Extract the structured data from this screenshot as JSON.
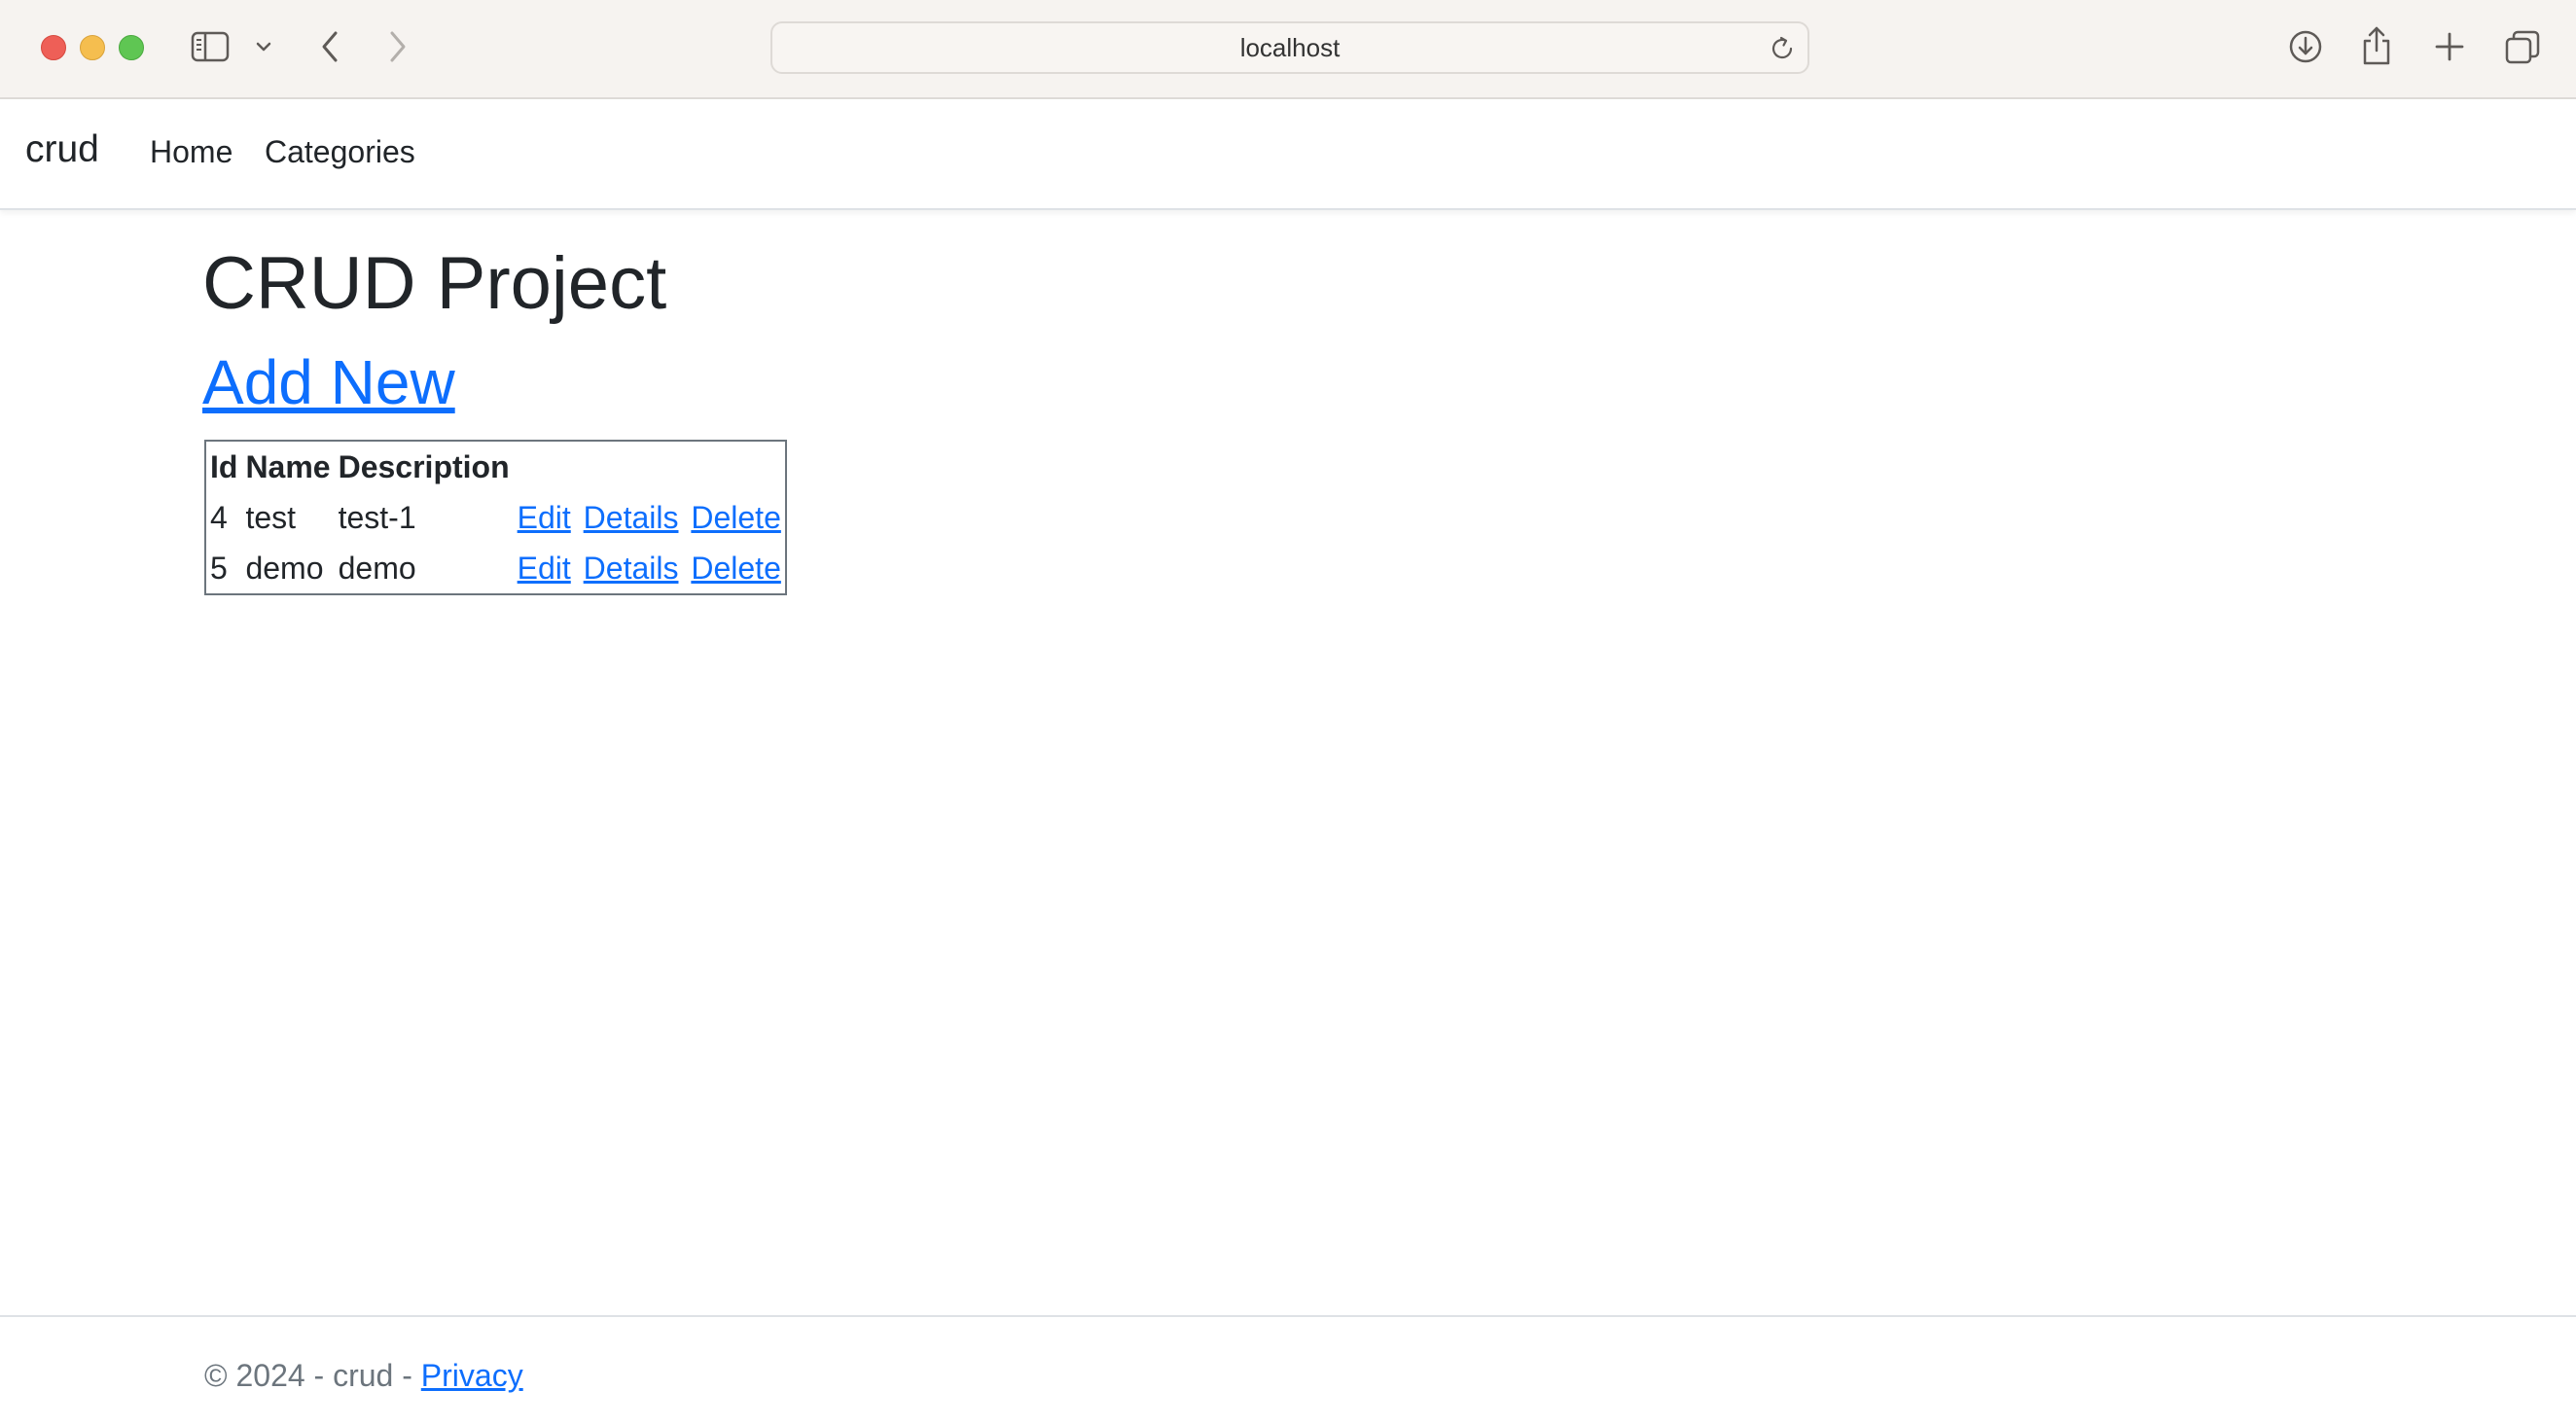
{
  "browser": {
    "address": "localhost",
    "icons": [
      "sidebar-icon",
      "chevron-down-icon",
      "back-icon",
      "forward-icon",
      "reload-icon",
      "download-icon",
      "share-icon",
      "plus-icon",
      "tabs-icon"
    ]
  },
  "navbar": {
    "brand": "crud",
    "links": [
      {
        "label": "Home"
      },
      {
        "label": "Categories"
      }
    ]
  },
  "main": {
    "title": "CRUD Project",
    "add_new": "Add New",
    "table": {
      "headers": [
        "Id",
        "Name",
        "Description",
        ""
      ],
      "rows": [
        {
          "id": "4",
          "name": "test",
          "description": "test-1",
          "actions": [
            "Edit",
            "Details",
            "Delete"
          ]
        },
        {
          "id": "5",
          "name": "demo",
          "description": "demo",
          "actions": [
            "Edit",
            "Details",
            "Delete"
          ]
        }
      ]
    }
  },
  "footer": {
    "text": "© 2024 - crud - ",
    "privacy": "Privacy"
  },
  "colors": {
    "link": "#0d6efd",
    "text": "#212529",
    "muted": "#6c757d",
    "chrome_bg": "#f6f3f0"
  }
}
